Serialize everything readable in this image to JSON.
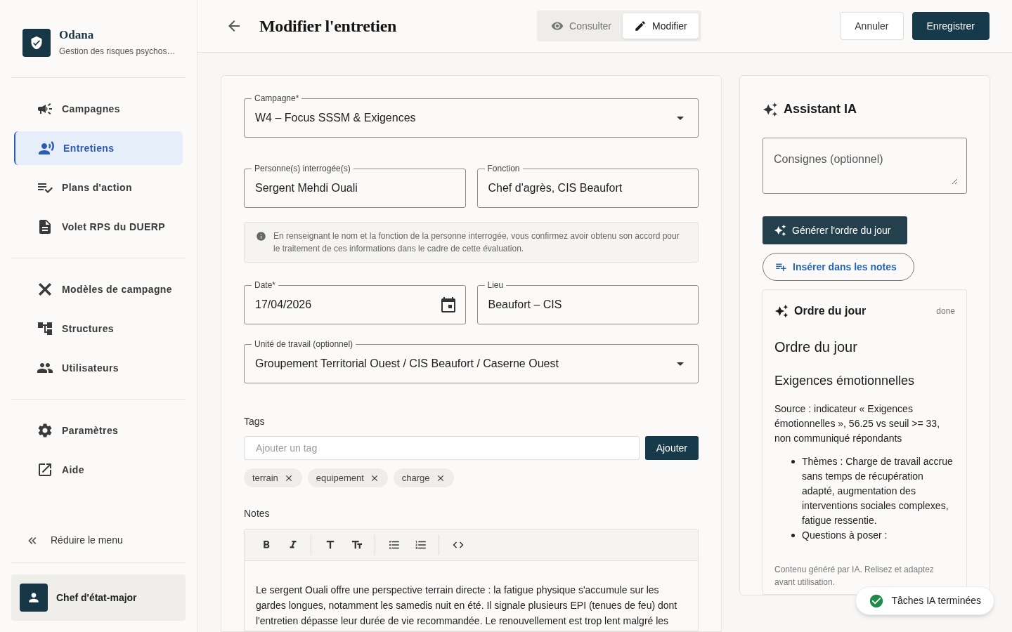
{
  "brand": {
    "name": "Odana",
    "subtitle": "Gestion des risques psychos…"
  },
  "nav_groups": [
    [
      {
        "label": "Campagnes",
        "selected": false
      },
      {
        "label": "Entretiens",
        "selected": true
      },
      {
        "label": "Plans d'action",
        "selected": false
      },
      {
        "label": "Volet RPS du DUERP",
        "selected": false
      }
    ],
    [
      {
        "label": "Modèles de campagne",
        "selected": false
      },
      {
        "label": "Structures",
        "selected": false
      },
      {
        "label": "Utilisateurs",
        "selected": false
      }
    ],
    [
      {
        "label": "Paramètres",
        "selected": false
      },
      {
        "label": "Aide",
        "selected": false
      }
    ]
  ],
  "collapse_menu": "Réduire le menu",
  "user": {
    "name": "Chef d'état-major"
  },
  "header": {
    "title": "Modifier l'entretien",
    "view_toggle": [
      {
        "label": "Consulter",
        "selected": false
      },
      {
        "label": "Modifier",
        "selected": true
      }
    ],
    "buttons": [
      {
        "label": "Annuler",
        "kind": "secondary"
      },
      {
        "label": "Enregistrer",
        "kind": "primary"
      }
    ]
  },
  "form": {
    "rows": [
      [
        {
          "label": "Campagne*",
          "value": "W4 – Focus SSSM & Exigences",
          "kind": "select"
        }
      ],
      [
        {
          "label": "Personne(s) interrogée(s)",
          "value": "Sergent Mehdi Ouali",
          "kind": "text"
        },
        {
          "label": "Fonction",
          "value": "Chef d'agrès, CIS Beaufort",
          "kind": "text"
        }
      ],
      [
        {
          "label": "Date*",
          "value": "17/04/2026",
          "kind": "date"
        },
        {
          "label": "Lieu",
          "value": "Beaufort – CIS",
          "kind": "text"
        }
      ],
      [
        {
          "label": "Unité de travail (optionnel)",
          "value": "Groupement Territorial Ouest / CIS Beaufort / Caserne Ouest",
          "kind": "select"
        }
      ]
    ],
    "notice": "En renseignant le nom et la fonction de la personne interrogée, vous confirmez avoir obtenu son accord pour le traitement de ces informations dans le cadre de cette évaluation.",
    "tags": {
      "label": "Tags",
      "placeholder": "Ajouter un tag",
      "add_button": "Ajouter",
      "items": [
        "terrain",
        "equipement",
        "charge"
      ]
    },
    "notes": {
      "label": "Notes",
      "text": "Le sergent Ouali offre une perspective terrain directe : la fatigue physique s'accumule sur les gardes longues, notamment les samedis nuit en été. Il signale plusieurs EPI (tenues de feu) dont l'entretien dépasse leur durée de vie recommandée. Le renouvellement est trop lent malgré les"
    }
  },
  "assistant": {
    "title": "Assistant IA",
    "instructions_placeholder": "Consignes (optionnel)",
    "generate_button": "Générer l'ordre du jour",
    "insert_button": "Insérer dans les notes",
    "result": {
      "title": "Ordre du jour",
      "status": "done",
      "heading": "Ordre du jour",
      "subheading": "Exigences émotionnelles",
      "paragraph": "Source : indicateur « Exigences émotionnelles », 56.25 vs seuil >= 33, non communiqué répondants",
      "bullets": [
        "Thèmes : Charge de travail accrue sans temps de récupération adapté, augmentation des interventions sociales complexes, fatigue ressentie.",
        "Questions à poser :"
      ],
      "disclaimer": "Contenu généré par IA. Relisez et adaptez avant utilisation."
    }
  },
  "toast": {
    "text": "Tâches IA terminées"
  }
}
